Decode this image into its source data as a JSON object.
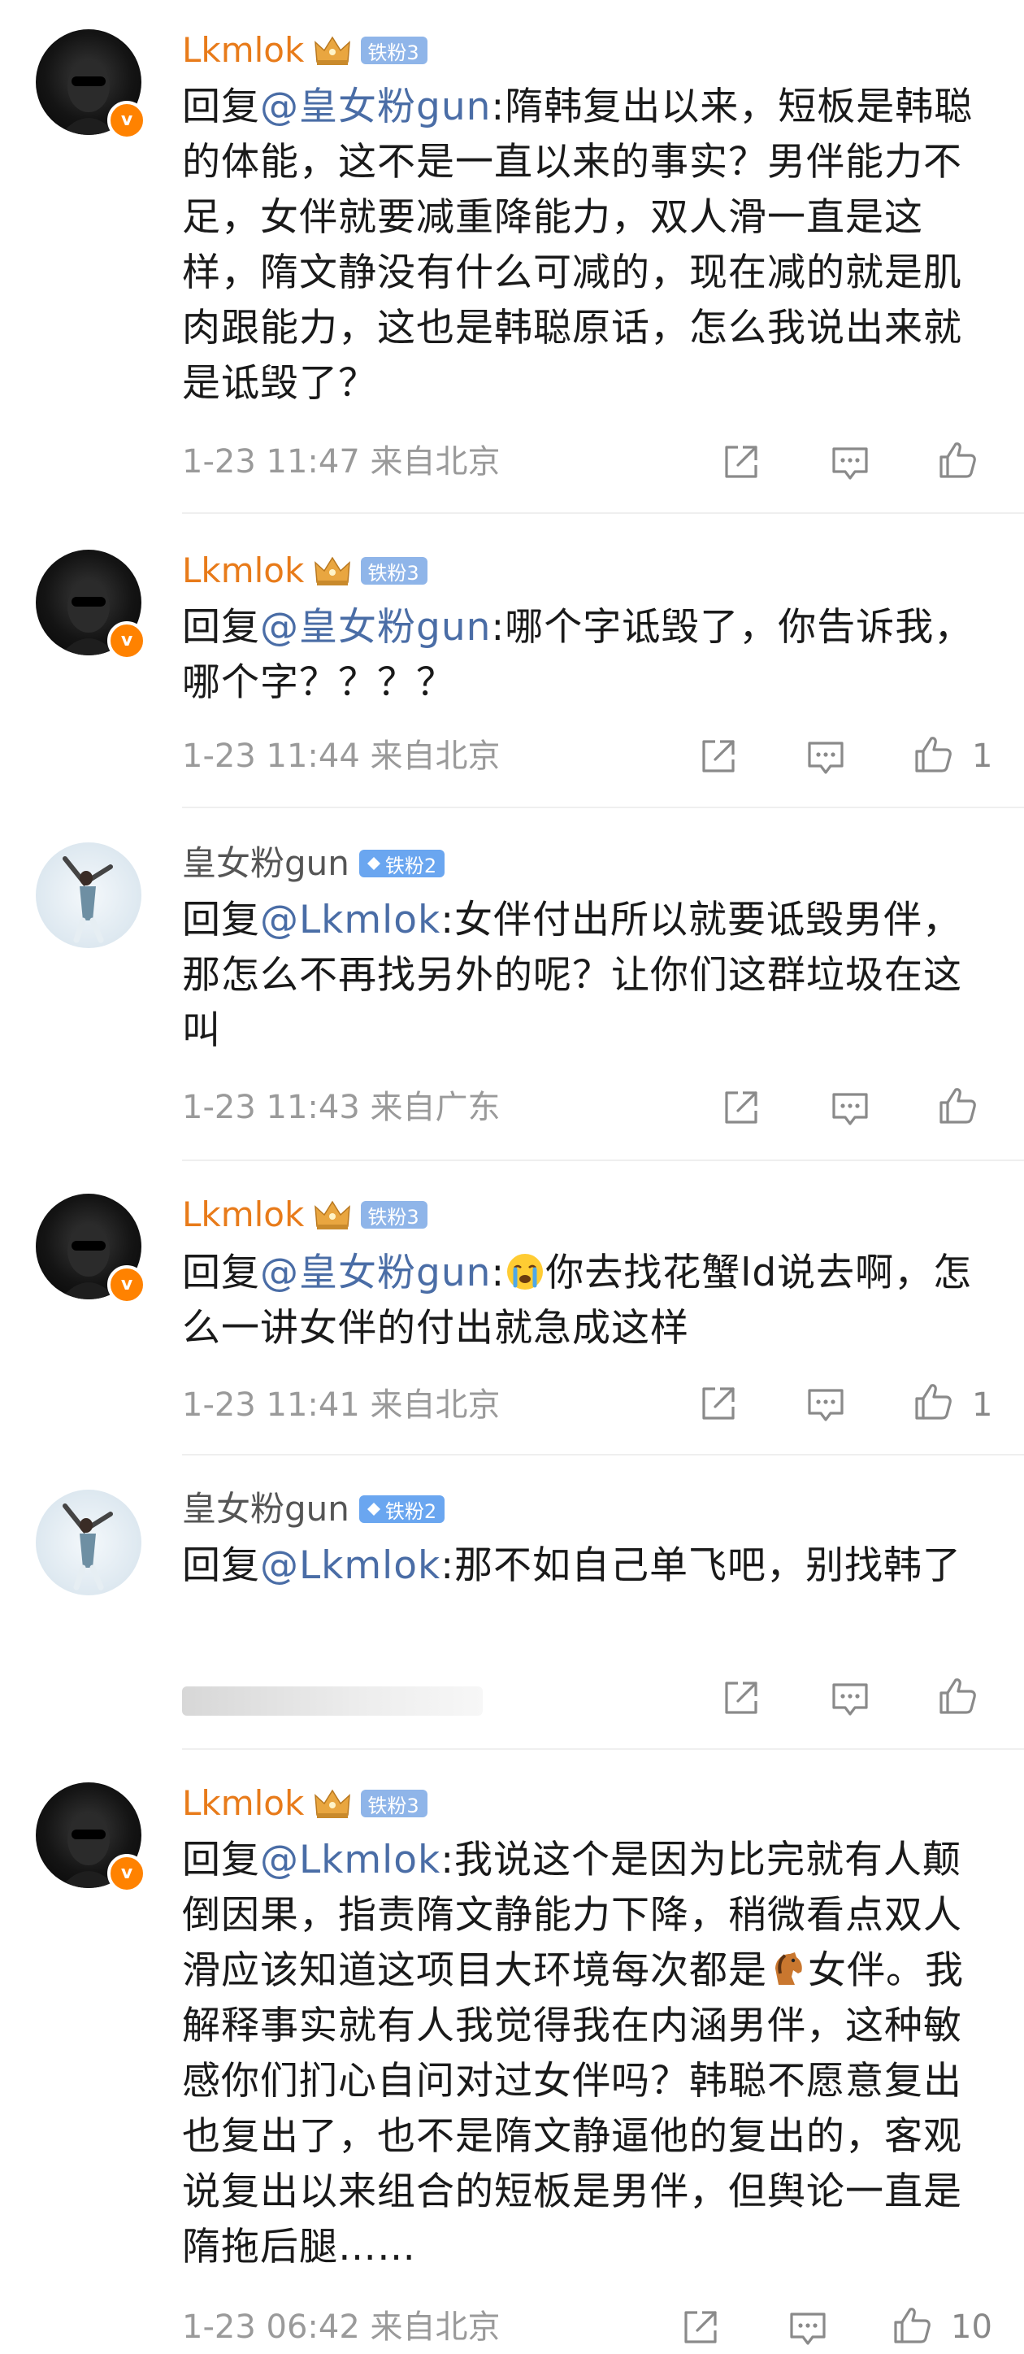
{
  "comments": [
    {
      "username": "Lkmlok",
      "fan_badge": "铁粉3",
      "verified_badge": "v",
      "reply_prefix": "回复",
      "mention": "@皇女粉gun",
      "body": ":隋韩复出以来，短板是韩聪的体能，这不是一直以来的事实？男伴能力不足，女伴就要减重降能力，双人滑一直是这样，隋文静没有什么可减的，现在减的就是肌肉跟能力，这也是韩聪原话，怎么我说出来就是诋毁了？",
      "timestamp": "1-23 11:47",
      "location": "来自北京",
      "like_count": ""
    },
    {
      "username": "Lkmlok",
      "fan_badge": "铁粉3",
      "verified_badge": "v",
      "reply_prefix": "回复",
      "mention": "@皇女粉gun",
      "body": ":哪个字诋毁了，你告诉我，哪个字？？？？",
      "timestamp": "1-23 11:44",
      "location": "来自北京",
      "like_count": "1"
    },
    {
      "username": "皇女粉gun",
      "fan_badge": "铁粉2",
      "reply_prefix": "回复",
      "mention": "@Lkmlok",
      "body": ":女伴付出所以就要诋毁男伴，那怎么不再找另外的呢？让你们这群垃圾在这叫",
      "timestamp": "1-23 11:43",
      "location": "来自广东",
      "like_count": ""
    },
    {
      "username": "Lkmlok",
      "fan_badge": "铁粉3",
      "verified_badge": "v",
      "reply_prefix": "回复",
      "mention": "@皇女粉gun",
      "body_before_emoji": ":",
      "emoji": "crying-face",
      "body": "你去找花蟹ld说去啊，怎么一讲女伴的付出就急成这样",
      "timestamp": "1-23 11:41",
      "location": "来自北京",
      "like_count": "1"
    },
    {
      "username": "皇女粉gun",
      "fan_badge": "铁粉2",
      "reply_prefix": "回复",
      "mention": "@Lkmlok",
      "body": ":那不如自己单飞吧，别找韩了",
      "timestamp": "",
      "location": "",
      "like_count": ""
    },
    {
      "username": "Lkmlok",
      "fan_badge": "铁粉3",
      "verified_badge": "v",
      "reply_prefix": "回复",
      "mention": "@Lkmlok",
      "body": ":我说这个是因为比完就有人颠倒因果，指责隋文静能力下降，稍微看点双人滑应该知道这项目大环境每次都是",
      "emoji": "horse-face",
      "body_after_emoji": "女伴。我解释事实就有人我觉得我在内涵男伴，这种敏感你们扪心自问对过女伴吗？韩聪不愿意复出也复出了，也不是隋文静逼他的复出的，客观说复出以来组合的短板是男伴，但舆论一直是隋拖后腿……",
      "timestamp": "1-23 06:42",
      "location": "来自北京",
      "like_count": "10"
    }
  ],
  "icons": {
    "share": "share-icon",
    "comment": "comment-icon",
    "like": "like-icon",
    "crown": "crown-icon"
  },
  "colors": {
    "username_orange": "#e87b1a",
    "mention_blue": "#4a6da6",
    "verified_orange": "#ff8200",
    "fan_badge_blue": "#8fb5e9"
  }
}
